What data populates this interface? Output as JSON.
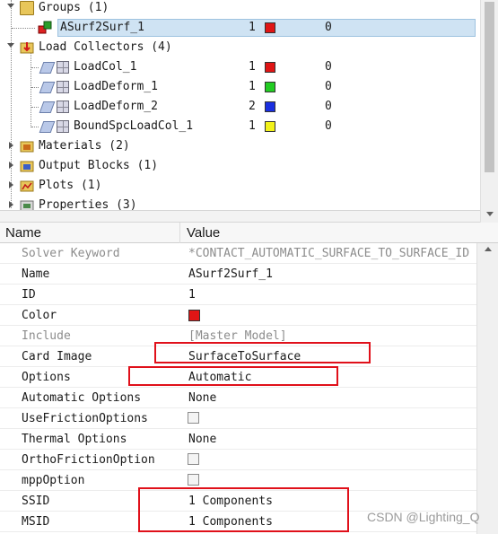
{
  "tree": {
    "rows": [
      {
        "label": "Groups (1)",
        "icon": "folder-icon"
      },
      {
        "label": "ASurf2Surf_1",
        "icon": "group-contact-icon",
        "count": "1",
        "swatch": "#e01515",
        "zero": "0"
      },
      {
        "label": "Load Collectors (4)",
        "icon": "folder-icon"
      },
      {
        "label": "LoadCol_1",
        "icon": "load-collector-icon",
        "count": "1",
        "swatch": "#e01515",
        "zero": "0"
      },
      {
        "label": "LoadDeform_1",
        "icon": "load-collector-icon",
        "count": "1",
        "swatch": "#22cc22",
        "zero": "0"
      },
      {
        "label": "LoadDeform_2",
        "icon": "load-collector-icon",
        "count": "2",
        "swatch": "#1a2fe0",
        "zero": "0"
      },
      {
        "label": "BoundSpcLoadCol_1",
        "icon": "load-collector-icon",
        "count": "1",
        "swatch": "#f2f21a",
        "zero": "0"
      },
      {
        "label": "Materials (2)",
        "icon": "materials-icon"
      },
      {
        "label": "Output Blocks (1)",
        "icon": "output-blocks-icon"
      },
      {
        "label": "Plots (1)",
        "icon": "plots-icon"
      },
      {
        "label": "Properties (3)",
        "icon": "properties-icon"
      }
    ]
  },
  "props": {
    "header": {
      "name": "Name",
      "value": "Value"
    },
    "rows": [
      {
        "name": "Solver Keyword",
        "value": "*CONTACT_AUTOMATIC_SURFACE_TO_SURFACE_ID"
      },
      {
        "name": "Name",
        "value": "ASurf2Surf_1"
      },
      {
        "name": "ID",
        "value": "1"
      },
      {
        "name": "Color",
        "value": "",
        "swatch": "#e01515"
      },
      {
        "name": "Include",
        "value": "[Master Model]"
      },
      {
        "name": "Card Image",
        "value": "SurfaceToSurface"
      },
      {
        "name": "Options",
        "value": "Automatic"
      },
      {
        "name": "Automatic Options",
        "value": "None"
      },
      {
        "name": "UseFrictionOptions",
        "value": "",
        "checkbox": false
      },
      {
        "name": "Thermal Options",
        "value": "None"
      },
      {
        "name": "OrthoFrictionOption",
        "value": "",
        "checkbox": false
      },
      {
        "name": "mppOption",
        "value": "",
        "checkbox": false
      },
      {
        "name": "SSID",
        "value": "1 Components"
      },
      {
        "name": "MSID",
        "value": "1 Components"
      }
    ]
  },
  "watermark": "CSDN @Lighting_Q",
  "colors": {
    "selection": "#cfe3f3",
    "annotation": "#e0101a"
  }
}
